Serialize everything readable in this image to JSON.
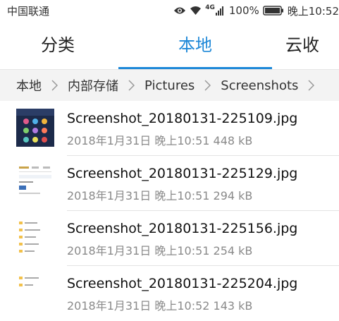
{
  "status": {
    "carrier": "中国联通",
    "network": "4G",
    "battery": "100%",
    "time": "晚上10:52"
  },
  "tabs": [
    {
      "label": "分类",
      "active": false
    },
    {
      "label": "本地",
      "active": true
    },
    {
      "label": "云收藏",
      "active": false
    }
  ],
  "breadcrumb": [
    "本地",
    "内部存储",
    "Pictures",
    "Screenshots"
  ],
  "files": [
    {
      "name": "Screenshot_20180131-225109.jpg",
      "meta": "2018年1月31日 晚上10:51 448 kB",
      "thumb": "dark"
    },
    {
      "name": "Screenshot_20180131-225129.jpg",
      "meta": "2018年1月31日 晚上10:51 294 kB",
      "thumb": "light"
    },
    {
      "name": "Screenshot_20180131-225156.jpg",
      "meta": "2018年1月31日 晚上10:51 254 kB",
      "thumb": "list"
    },
    {
      "name": "Screenshot_20180131-225204.jpg",
      "meta": "2018年1月31日 晚上10:52 143 kB",
      "thumb": "list"
    }
  ],
  "colors": {
    "accent": "#1e88d8"
  }
}
